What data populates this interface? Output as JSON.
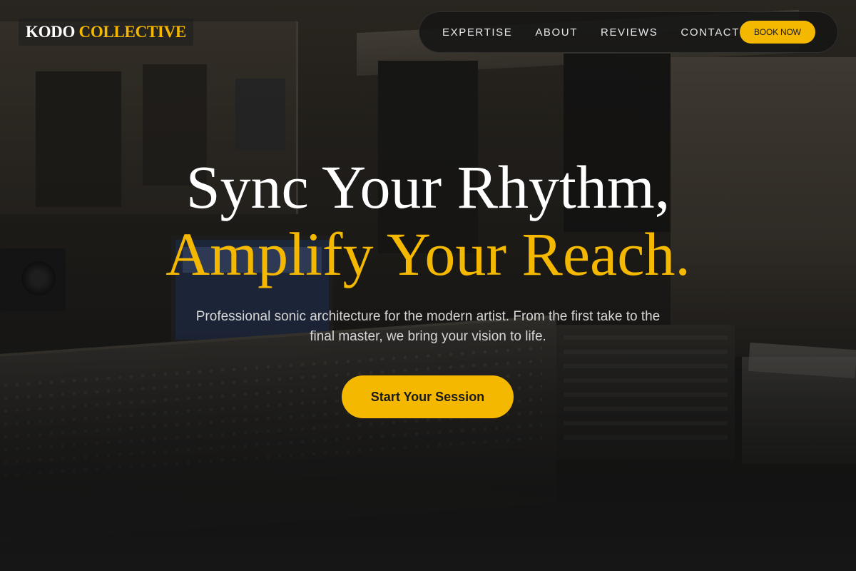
{
  "brand": {
    "logo_part1": "KODO",
    "logo_part2": "COLLECTIVE"
  },
  "nav": {
    "items": [
      {
        "label": "EXPERTISE"
      },
      {
        "label": "ABOUT"
      },
      {
        "label": "REVIEWS"
      },
      {
        "label": "CONTACT"
      }
    ],
    "book_label": "BOOK NOW"
  },
  "hero": {
    "headline_line1": "Sync Your Rhythm,",
    "headline_line2": "Amplify Your Reach.",
    "subtitle": "Professional sonic architecture for the modern artist. From the first take to the final master, we bring your vision to life.",
    "cta_label": "Start Your Session",
    "background_image": "recording-studio-control-room"
  },
  "colors": {
    "accent": "#f5b800",
    "text_light": "#ffffff",
    "nav_bg": "#161616"
  }
}
